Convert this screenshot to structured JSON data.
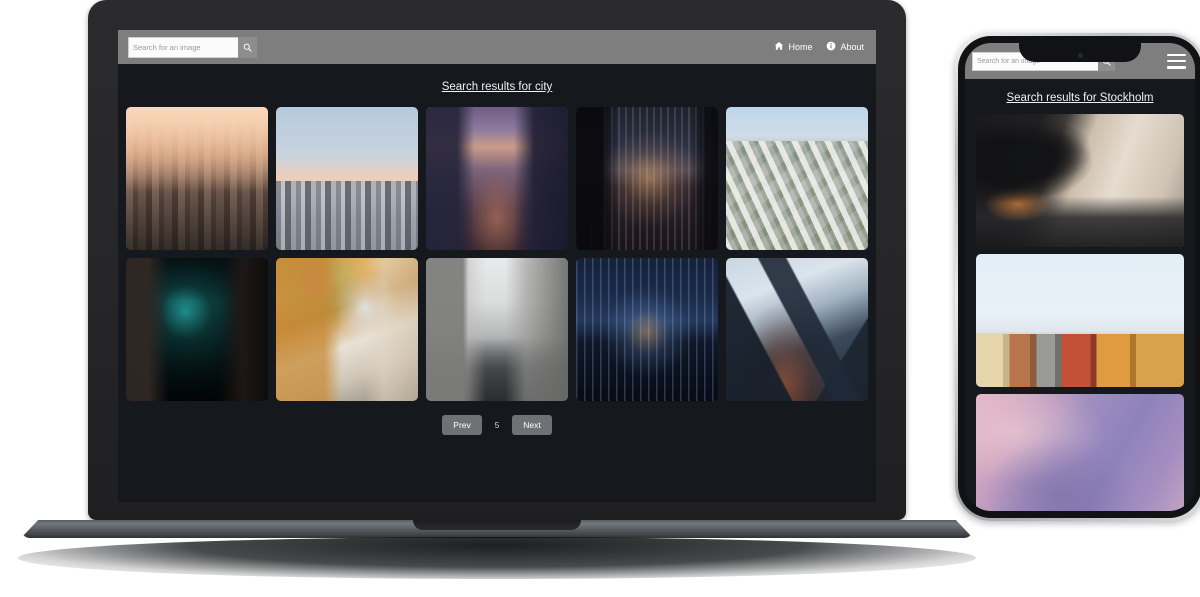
{
  "desktop": {
    "nav": {
      "search": {
        "placeholder": "Search for an image",
        "value": "",
        "button_icon": "search-icon"
      },
      "links": [
        {
          "label": "Home",
          "icon": "home-icon"
        },
        {
          "label": "About",
          "icon": "info-circle-icon"
        }
      ]
    },
    "heading": "Search results for city",
    "results": [
      {
        "alt": "Warm sepia city skyline at sunrise",
        "style": "ph-skyline-warm"
      },
      {
        "alt": "Pale blue and pink skyline with Empire State Building",
        "style": "ph-skyline-blue"
      },
      {
        "alt": "Purple dusk view over Chicago river and towers",
        "style": "ph-chicago"
      },
      {
        "alt": "Dark night cityscape seen from a balcony",
        "style": "ph-night-city"
      },
      {
        "alt": "Bright daytime aerial view of a downtown district",
        "style": "ph-aerial-day"
      },
      {
        "alt": "Dark alley lit with teal neon light",
        "style": "ph-teal-alley"
      },
      {
        "alt": "Yellow European street with flower balconies",
        "style": "ph-yellow-street"
      },
      {
        "alt": "Empty grey street canyon between tall buildings",
        "style": "ph-grey-street"
      },
      {
        "alt": "Blue night skyline reflected in water",
        "style": "ph-dubai"
      },
      {
        "alt": "Glass towers seen looking upward against the sky",
        "style": "ph-glass-towers"
      }
    ],
    "pagination": {
      "prev_label": "Prev",
      "page": "5",
      "next_label": "Next"
    }
  },
  "phone": {
    "nav": {
      "search": {
        "placeholder": "Search for an image",
        "value": "",
        "button_icon": "search-icon"
      },
      "menu_icon": "hamburger-menu-icon"
    },
    "heading": "Search results for Stockholm",
    "results": [
      {
        "alt": "Train seats beside a bright window",
        "style": "ph-train-seats"
      },
      {
        "alt": "Colourful old town houses in Stockholm",
        "style": "ph-stockholm"
      },
      {
        "alt": "Purple and pink sunset sky",
        "style": "ph-purple-sky"
      }
    ]
  },
  "colors": {
    "page_background": "#15181c",
    "nav_background": "#7e7e7e",
    "button_background": "#6f7275",
    "text_light": "#f2f2f2",
    "laptop_bezel": "#2a2a2c",
    "phone_frame": "#c8cbcf"
  }
}
